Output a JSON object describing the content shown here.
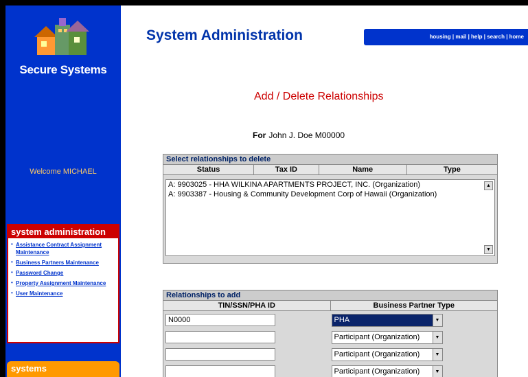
{
  "sidebar": {
    "brand": "Secure Systems",
    "welcome": "Welcome MICHAEL",
    "section_title": "system administration",
    "links": [
      "Assistance Contract Assignment Maintenance",
      "Business Partners Maintenance",
      "Password Change",
      "Property Assignment Maintenance",
      "User Maintenance"
    ],
    "systems_title": "systems"
  },
  "header": {
    "title": "System Administration",
    "nav": [
      "housing",
      "mail",
      "help",
      "search",
      "home"
    ]
  },
  "main": {
    "subtitle": "Add / Delete Relationships",
    "for_label": "For",
    "for_value": "John J. Doe M00000",
    "delete_panel": {
      "title": "Select relationships to delete",
      "columns": [
        "Status",
        "Tax ID",
        "Name",
        "Type"
      ],
      "rows": [
        "A: 9903025 -    HHA WILKINA APARTMENTS PROJECT, INC. (Organization)",
        "A: 9903387 -    Housing & Community Development Corp of Hawaii (Organization)"
      ]
    },
    "add_panel": {
      "title": "Relationships to add",
      "columns": [
        "TIN/SSN/PHA ID",
        "Business Partner Type"
      ],
      "rows": [
        {
          "id": "N0000",
          "type": "PHA"
        },
        {
          "id": "",
          "type": "Participant (Organization)"
        },
        {
          "id": "",
          "type": "Participant (Organization)"
        },
        {
          "id": "",
          "type": "Participant (Organization)"
        }
      ]
    }
  },
  "colors": {
    "sidebar_blue": "#0033cc",
    "accent_red": "#cc0000",
    "systems_orange": "#ff9900"
  }
}
